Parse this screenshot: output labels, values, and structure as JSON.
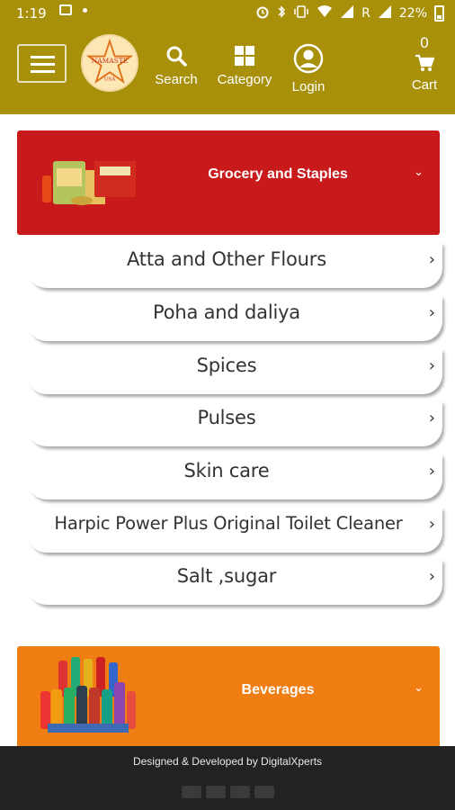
{
  "status_bar": {
    "time": "1:19",
    "roaming": "R",
    "battery": "22%",
    "icons": [
      "image-icon",
      "dot-icon",
      "alarm-icon",
      "bluetooth-icon",
      "vibrate-icon",
      "wifi-icon",
      "signal-icon",
      "signal-icon",
      "battery-icon"
    ]
  },
  "header": {
    "logo_text_top": "NAMASTE",
    "logo_text_bottom": "USA",
    "nav": {
      "search": "Search",
      "category": "Category",
      "login": "Login",
      "cart": "Cart",
      "cart_count": "0"
    }
  },
  "categories": [
    {
      "title": "Grocery and Staples",
      "color": "#c8191b",
      "icon": "grocery-products-image",
      "items": [
        {
          "label": "Atta and Other Flours"
        },
        {
          "label": "Poha and daliya"
        },
        {
          "label": "Spices"
        },
        {
          "label": "Pulses"
        },
        {
          "label": "Skin care"
        },
        {
          "label": "Harpic Power Plus Original Toilet Cleaner"
        },
        {
          "label": "Salt ,sugar"
        }
      ]
    },
    {
      "title": "Beverages",
      "color": "#f07e12",
      "icon": "beverage-bottles-image"
    }
  ],
  "footer": {
    "credit": "Designed & Developed by DigitalXperts",
    "payment_icons": [
      "card-icon",
      "visa-icon",
      "paypal-icon",
      "payoneer-icon"
    ]
  },
  "colors": {
    "header_bg": "#a8900b",
    "footer_bg": "#222222"
  }
}
